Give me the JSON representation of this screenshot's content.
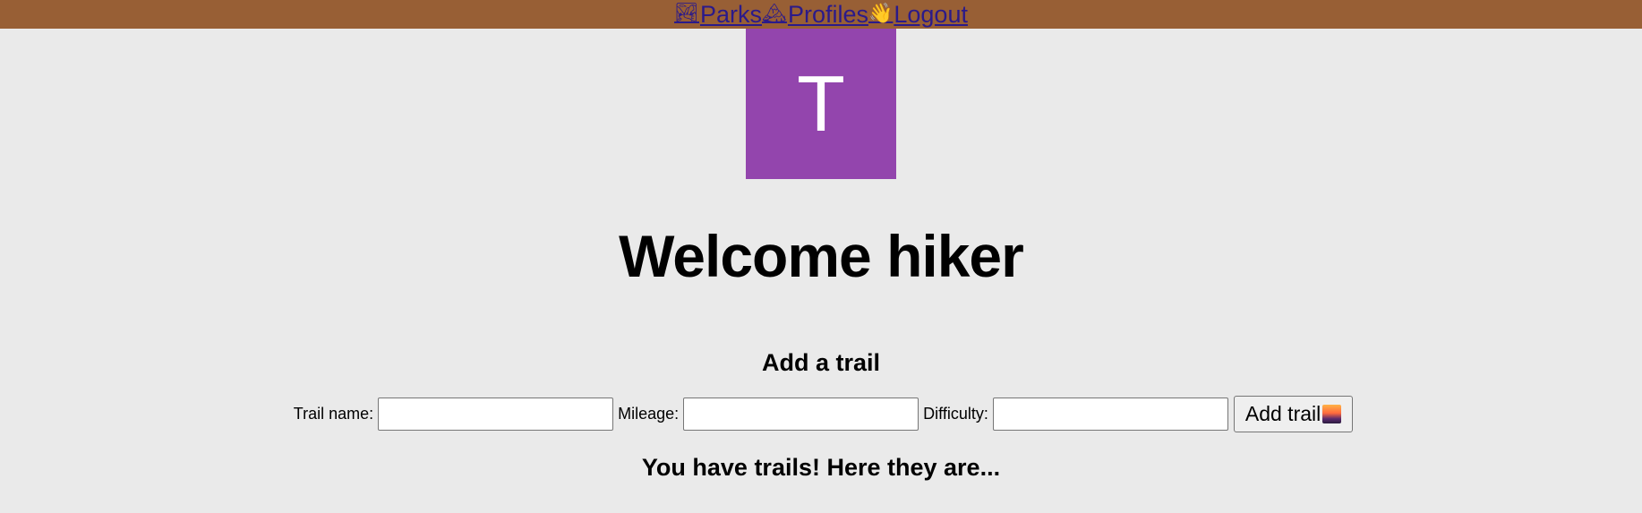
{
  "nav": {
    "items": [
      {
        "emoji": "🏞",
        "label": "Parks",
        "icon": "national-park-icon"
      },
      {
        "emoji": "🏔",
        "label": "Profiles",
        "icon": "mountain-icon"
      },
      {
        "emoji": "👋",
        "label": "Logout",
        "icon": "waving-hand-icon"
      }
    ],
    "background": "#985f35",
    "link_color": "#2b1a8a"
  },
  "avatar": {
    "initial": "T",
    "color": "#9345ad"
  },
  "welcome": {
    "title": "Welcome hiker"
  },
  "add_trail": {
    "heading": "Add a trail",
    "fields": [
      {
        "label": "Trail name:",
        "value": ""
      },
      {
        "label": "Mileage:",
        "value": ""
      },
      {
        "label": "Difficulty:",
        "value": ""
      }
    ],
    "button_label": "Add trail",
    "button_icon": "sunrise-over-mountains-icon"
  },
  "trails": {
    "heading": "You have trails! Here they are..."
  }
}
